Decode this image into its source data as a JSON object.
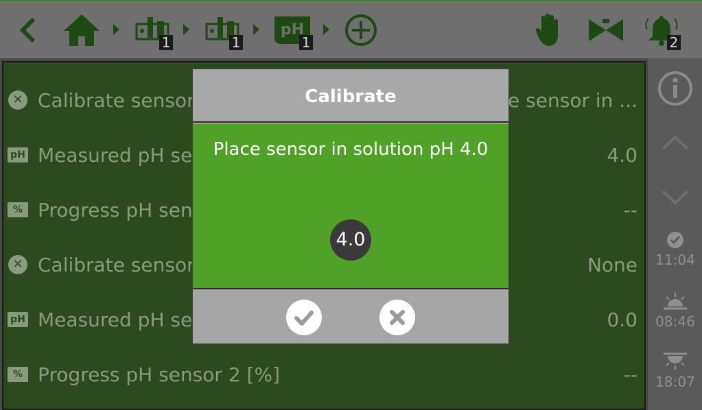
{
  "topbar": {
    "breadcrumbs": [
      {
        "icon": "controller-icon",
        "badge": "1"
      },
      {
        "icon": "controller-icon",
        "badge": "1"
      },
      {
        "icon": "ph-sensor-icon",
        "icon_text": "pH",
        "badge": "1"
      }
    ],
    "alarm_badge": "2"
  },
  "list": {
    "rows": [
      {
        "icon": "x-circle-icon",
        "icon_text": "✕",
        "label": "Calibrate sensor",
        "value": "e sensor in ..."
      },
      {
        "icon": "ph-icon",
        "icon_text": "pH",
        "label": "Measured pH se",
        "value": "4.0"
      },
      {
        "icon": "percent-icon",
        "icon_text": "%",
        "label": "Progress pH sen",
        "value": "--"
      },
      {
        "icon": "x-circle-icon",
        "icon_text": "✕",
        "label": "Calibrate sensor",
        "value": "None"
      },
      {
        "icon": "ph-icon",
        "icon_text": "pH",
        "label": "Measured pH se",
        "value": "0.0"
      },
      {
        "icon": "percent-icon",
        "icon_text": "%",
        "label": "Progress pH sensor 2 [%]",
        "value": "--"
      }
    ]
  },
  "sidebar": {
    "times": [
      {
        "icon": "check-clock-icon",
        "time": "11:04"
      },
      {
        "icon": "sunrise-icon",
        "time": "08:46"
      },
      {
        "icon": "sunset-icon",
        "time": "18:07"
      }
    ]
  },
  "dialog": {
    "title": "Calibrate",
    "message": "Place sensor in solution pH 4.0",
    "value": "4.0"
  },
  "colors": {
    "accent_green": "#4fa128",
    "dark_green": "#1c4a12",
    "list_bg": "#2c4a1e"
  }
}
